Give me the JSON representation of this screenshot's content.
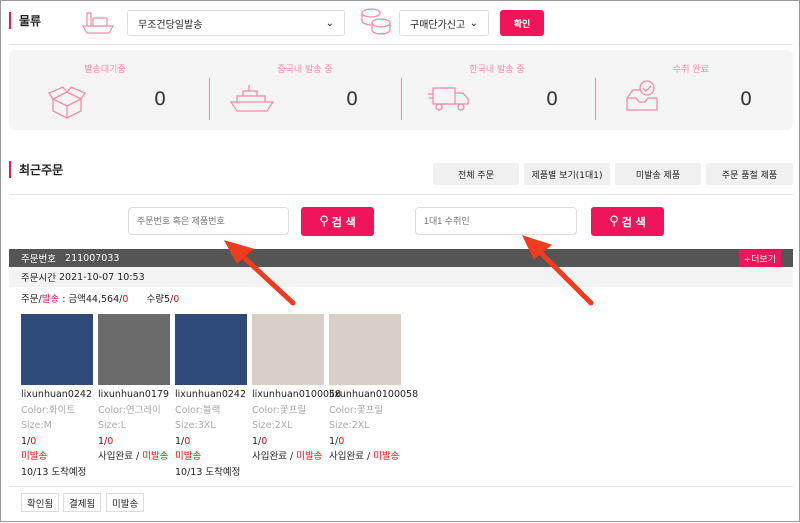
{
  "logistics": {
    "title": "물류",
    "shipping_method": "무조건당일발송",
    "price_option": "구매단가신고",
    "confirm_label": "확인"
  },
  "stats": [
    {
      "label": "발송대기중",
      "value": "0",
      "icon": "open-box-icon"
    },
    {
      "label": "중국내 발송 중",
      "value": "0",
      "icon": "ship-icon"
    },
    {
      "label": "한국내 발송 중",
      "value": "0",
      "icon": "truck-icon"
    },
    {
      "label": "수취 완료",
      "value": "0",
      "icon": "received-tray-icon"
    }
  ],
  "recent": {
    "title": "최근주문",
    "tabs": [
      "전체 주문",
      "제품별 보기(1대1)",
      "미발송 제품",
      "주문 품절 제품"
    ]
  },
  "search": {
    "order_placeholder": "주문번호 혹은 제품번호",
    "recipient_placeholder": "1대1 수취인",
    "search_label": "검 색"
  },
  "order": {
    "number_label": "주문번호",
    "number": "211007033",
    "more_label": "+더보기",
    "time_label": "주문시간",
    "time": "2021-10-07 10:53",
    "summary": {
      "order_label": "주문/",
      "ship_label": "발송",
      "amount_label": " : 금액44,564/",
      "amount_shipped": "0",
      "qty_label": "수량5/",
      "qty_shipped": "0"
    },
    "items": [
      {
        "sku": "lixunhuan0242",
        "color": "Color:화이트",
        "size": "Size:M",
        "qty": "1/",
        "shipped": "0",
        "status_prefix": "",
        "status": "미발송",
        "arrival": "10/13 도착예정"
      },
      {
        "sku": "lixunhuan0179",
        "color": "Color:연그레이",
        "size": "Size:L",
        "qty": "1/",
        "shipped": "0",
        "status_prefix": "사입완료 / ",
        "status": "미발송",
        "arrival": ""
      },
      {
        "sku": "lixunhuan0242",
        "color": "Color:블랙",
        "size": "Size:3XL",
        "qty": "1/",
        "shipped": "0",
        "status_prefix": "",
        "status": "미발송",
        "arrival": "10/13 도착예정"
      },
      {
        "sku": "lixunhuan0100058",
        "color": "Color:꽃프릴",
        "size": "Size:2XL",
        "qty": "1/",
        "shipped": "0",
        "status_prefix": "사입완료 / ",
        "status": "미발송",
        "arrival": ""
      },
      {
        "sku": "lixunhuan0100058",
        "color": "Color:꽃프릴",
        "size": "Size:2XL",
        "qty": "1/",
        "shipped": "0",
        "status_prefix": "사입완료 / ",
        "status": "미발송",
        "arrival": ""
      }
    ],
    "tags": [
      "확인됨",
      "결제됨",
      "미발송"
    ]
  },
  "colors": {
    "accent": "#f0145a",
    "icon_pink": "#f68aa8",
    "header_dark": "#555555",
    "arrow": "#f03c1e"
  }
}
